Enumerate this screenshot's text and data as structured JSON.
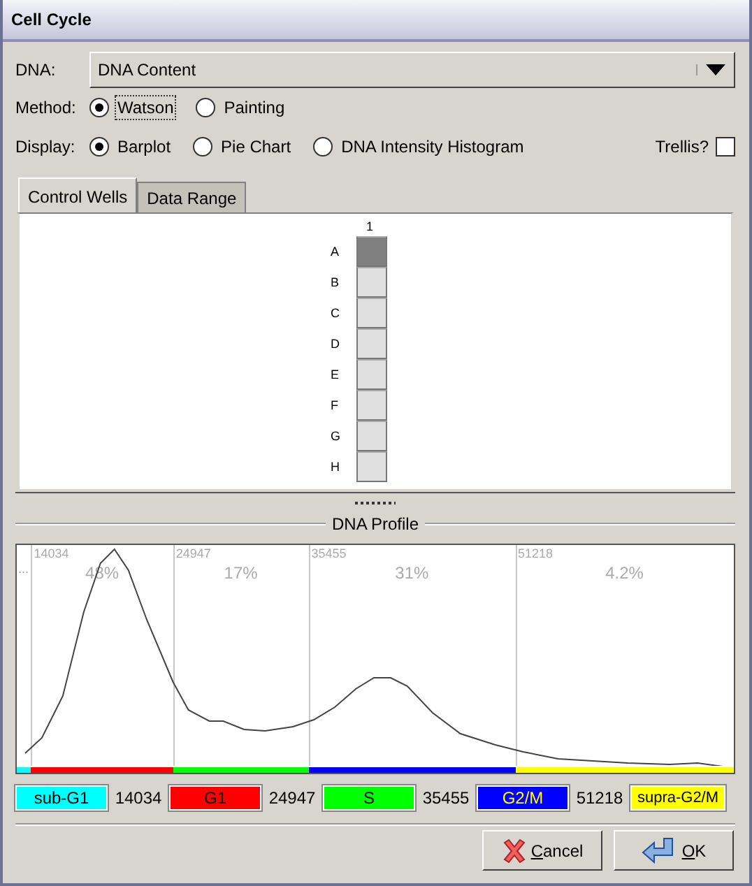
{
  "window": {
    "title": "Cell Cycle"
  },
  "dna": {
    "label": "DNA:",
    "value": "DNA Content"
  },
  "method": {
    "label": "Method:",
    "options": [
      {
        "label": "Watson",
        "selected": true,
        "focused": true
      },
      {
        "label": "Painting",
        "selected": false,
        "focused": false
      }
    ]
  },
  "display": {
    "label": "Display:",
    "options": [
      {
        "label": "Barplot",
        "selected": true,
        "focused": false
      },
      {
        "label": "Pie Chart",
        "selected": false,
        "focused": false
      },
      {
        "label": "DNA Intensity Histogram",
        "selected": false,
        "focused": false
      }
    ]
  },
  "trellis": {
    "label": "Trellis?",
    "checked": false
  },
  "tabs": [
    {
      "label": "Control Wells",
      "selected": true
    },
    {
      "label": "Data Range",
      "selected": false
    }
  ],
  "wells": {
    "column_label": "1",
    "rows": [
      {
        "label": "A",
        "selected": true
      },
      {
        "label": "B",
        "selected": false
      },
      {
        "label": "C",
        "selected": false
      },
      {
        "label": "D",
        "selected": false
      },
      {
        "label": "E",
        "selected": false
      },
      {
        "label": "F",
        "selected": false
      },
      {
        "label": "G",
        "selected": false
      },
      {
        "label": "H",
        "selected": false
      }
    ]
  },
  "profile": {
    "title": "DNA Profile",
    "corner_mark": "...",
    "segments": [
      {
        "threshold": "14034",
        "percent": "48%"
      },
      {
        "threshold": "24947",
        "percent": "17%"
      },
      {
        "threshold": "35455",
        "percent": "31%"
      },
      {
        "threshold": "51218",
        "percent": "4.2%"
      }
    ]
  },
  "legend": [
    {
      "label": "sub-G1",
      "color": "#00ffff",
      "value": "14034"
    },
    {
      "label": "G1",
      "color": "#ff0000",
      "value": "24947"
    },
    {
      "label": "S",
      "color": "#00ff00",
      "value": "35455"
    },
    {
      "label": "G2/M",
      "color": "#0000ff",
      "value": "51218"
    },
    {
      "label": "supra-G2/M",
      "color": "#ffff00"
    }
  ],
  "buttons": [
    {
      "kind": "cancel",
      "label": "Cancel"
    },
    {
      "kind": "ok",
      "label": "OK"
    }
  ]
}
